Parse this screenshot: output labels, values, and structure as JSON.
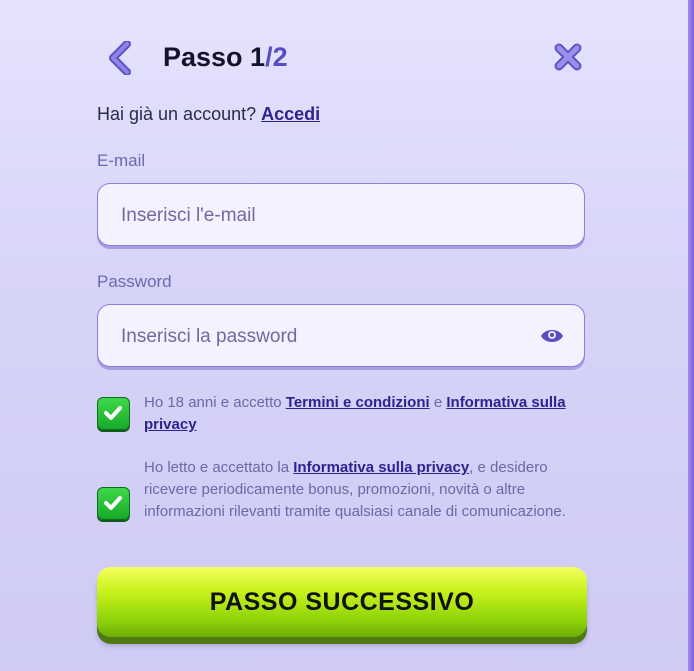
{
  "header": {
    "title_prefix": "Passo 1",
    "title_denominator": "/2",
    "back_icon": "chevron-left-icon",
    "close_icon": "close-icon"
  },
  "login": {
    "prompt": "Hai già un account?",
    "link": "Accedi"
  },
  "email": {
    "label": "E-mail",
    "placeholder": "Inserisci l'e-mail",
    "value": ""
  },
  "password": {
    "label": "Password",
    "placeholder": "Inserisci la password",
    "value": "",
    "toggle_icon": "eye-icon"
  },
  "consent1": {
    "checked": true,
    "text_before": "Ho 18 anni e accetto ",
    "link_terms": "Termini e condizioni",
    "text_mid": " e ",
    "link_privacy": "Informativa sulla privacy"
  },
  "consent2": {
    "checked": true,
    "text_before": "Ho letto e accettato la ",
    "link_privacy": "Informativa sulla privacy",
    "text_after": ", e desidero ricevere periodicamente bonus, promozioni, novità o altre informazioni rilevanti tramite qualsiasi canale di comunicazione."
  },
  "next_button": {
    "label": "PASSO SUCCESSIVO"
  },
  "colors": {
    "accent": "#5a4bc2",
    "link": "#2d2390",
    "check_green": "#18a92a",
    "button_lime": "#c8f21b"
  }
}
